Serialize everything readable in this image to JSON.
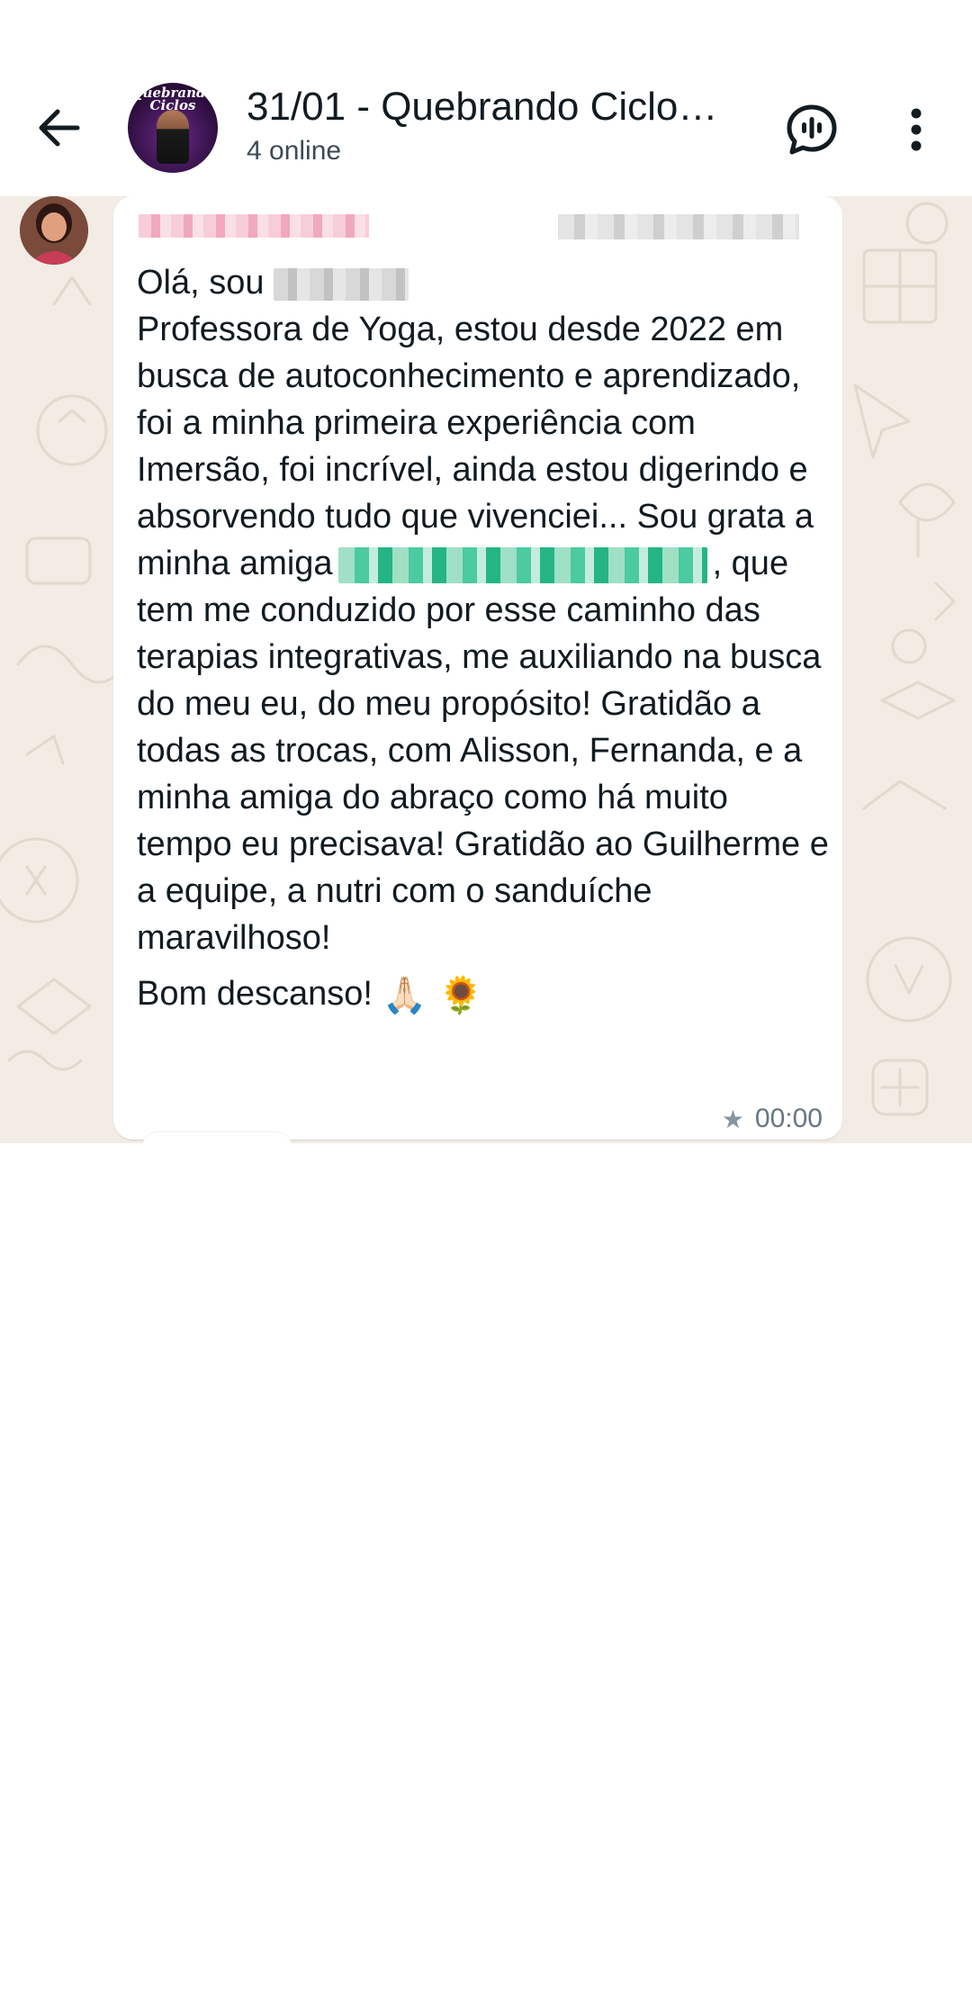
{
  "header": {
    "title": "31/01 - Quebrando Ciclo…",
    "subtitle": "4 online",
    "avatar_text": "Quebrando\nCiclos",
    "icons": {
      "back": "arrow-left-icon",
      "voice_chat": "voice-chat-icon",
      "menu": "more-vertical-icon"
    }
  },
  "message": {
    "intro": "Olá, sou",
    "body_1": "Professora de Yoga, estou desde 2022 em busca de autoconhecimento e aprendizado, foi a minha primeira experiência com Imersão, foi incrível, ainda estou digerindo e absorvendo tudo que vivenciei... Sou grata a minha amiga",
    "body_2": ", que tem me conduzido por esse caminho das terapias integrativas, me auxiliando na busca do meu eu, do meu propósito! Gratidão a todas as trocas, com Alisson, Fernanda, e a minha amiga do abraço como há muito tempo eu precisava! Gratidão ao Guilherme e a equipe, a nutri com o sanduíche maravilhoso!",
    "closing": "Bom descanso!",
    "emojis": "🙏🏻 🌻",
    "time": "00:00",
    "starred_icon": "★"
  },
  "colors": {
    "chat_background": "#f2ece4",
    "bubble": "#ffffff",
    "mention_green": "#25b585",
    "header_text": "#111b21"
  }
}
